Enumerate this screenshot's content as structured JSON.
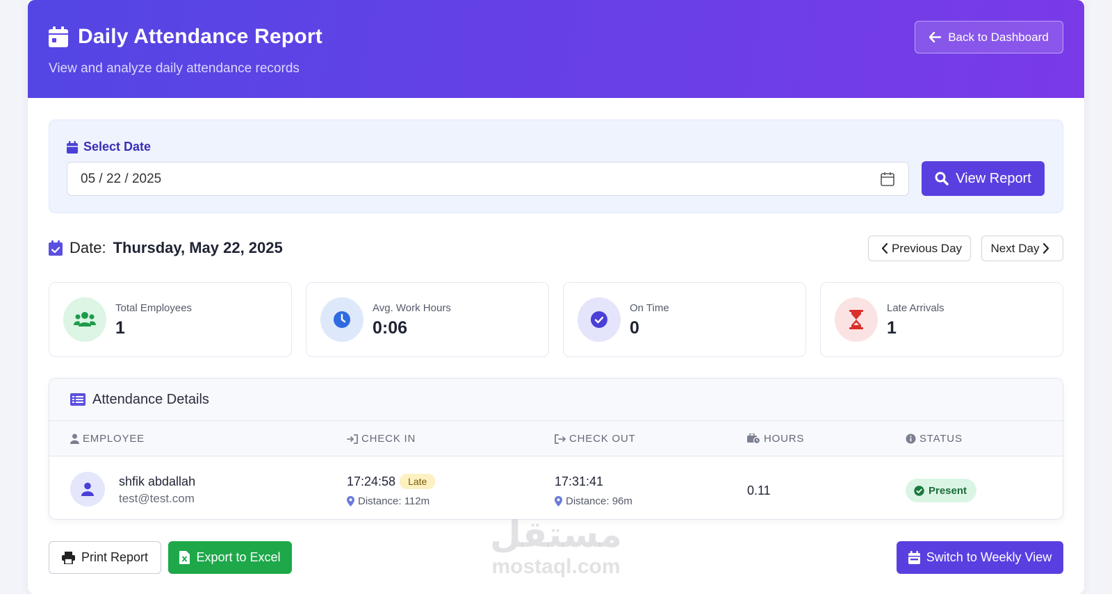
{
  "header": {
    "title": "Daily Attendance Report",
    "subtitle": "View and analyze daily attendance records",
    "back_label": "Back to Dashboard"
  },
  "date_picker": {
    "label": "Select Date",
    "value": "05 / 22 / 2025",
    "view_label": "View Report"
  },
  "current_date": {
    "label": "Date:",
    "value": "Thursday, May 22, 2025",
    "prev_label": "Previous Day",
    "next_label": "Next Day"
  },
  "stats": [
    {
      "label": "Total Employees",
      "value": "1",
      "icon": "users-icon",
      "color": "#1e9b4a"
    },
    {
      "label": "Avg. Work Hours",
      "value": "0:06",
      "icon": "clock-icon",
      "color": "#2f6be0"
    },
    {
      "label": "On Time",
      "value": "0",
      "icon": "check-circle-icon",
      "color": "#4a3fd6"
    },
    {
      "label": "Late Arrivals",
      "value": "1",
      "icon": "hourglass-icon",
      "color": "#d9302c"
    }
  ],
  "table": {
    "title": "Attendance Details",
    "columns": [
      "EMPLOYEE",
      "CHECK IN",
      "CHECK OUT",
      "HOURS",
      "STATUS"
    ],
    "rows": [
      {
        "name": "shfik abdallah",
        "email": "test@test.com",
        "check_in": "17:24:58",
        "check_in_badge": "Late",
        "check_in_distance": "Distance: 112m",
        "check_out": "17:31:41",
        "check_out_distance": "Distance: 96m",
        "hours": "0.11",
        "status": "Present"
      }
    ]
  },
  "footer": {
    "print_label": "Print Report",
    "excel_label": "Export to Excel",
    "weekly_label": "Switch to Weekly View"
  },
  "watermark": {
    "arabic": "مستقل",
    "latin": "mostaql.com"
  },
  "colors": {
    "accent": "#5a3fe0",
    "header_start": "#5346e4",
    "header_end": "#7a3ae8",
    "excel_green": "#1ea84a"
  }
}
